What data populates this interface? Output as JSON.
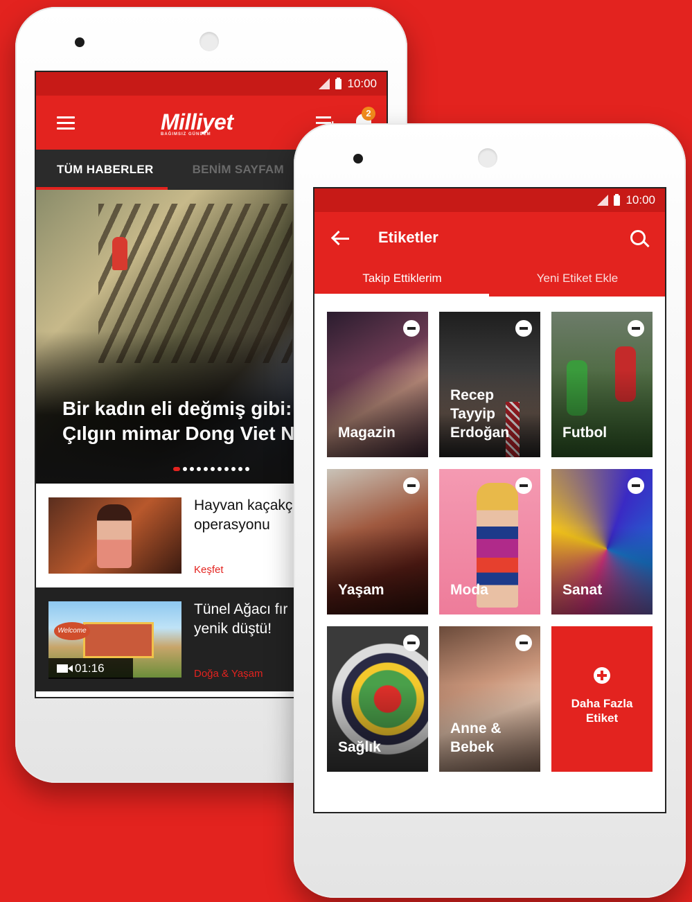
{
  "back_phone": {
    "status_time": "10:00",
    "brand": "Milliyet",
    "brand_tagline": "BAĞIMSIZ GÜNDEM",
    "notification_count": "2",
    "tabs": [
      "TÜM HABERLER",
      "BENİM SAYFAM"
    ],
    "hero": {
      "title_line1": "Bir kadın eli değmiş gibi:",
      "title_line2": "Çılgın mimar Dong Viet N"
    },
    "news": [
      {
        "title_line1": "Hayvan kaçakç",
        "title_line2": "operasyonu",
        "category": "Keşfet"
      },
      {
        "title_line1": "Tünel Ağacı fır",
        "title_line2": "yenik düştü!",
        "category": "Doğa & Yaşam",
        "video_duration": "01:16",
        "thumb_sign": "Welcome"
      }
    ]
  },
  "front_phone": {
    "status_time": "10:00",
    "title": "Etiketler",
    "tabs": [
      "Takip Ettiklerim",
      "Yeni Etiket Ekle"
    ],
    "tiles": [
      {
        "label": "Magazin"
      },
      {
        "label": "Recep\nTayyip\nErdoğan"
      },
      {
        "label": "Futbol"
      },
      {
        "label": "Yaşam"
      },
      {
        "label": "Moda"
      },
      {
        "label": "Sanat"
      },
      {
        "label": "Sağlık"
      },
      {
        "label": "Anne &\nBebek"
      }
    ],
    "more_tags": "Daha Fazla\nEtiket"
  }
}
